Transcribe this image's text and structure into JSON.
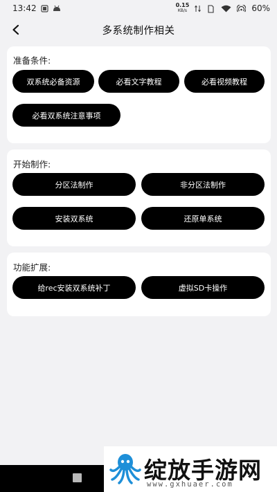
{
  "status_bar": {
    "time": "13:42",
    "net_speed_value": "0.15",
    "net_speed_unit": "KB/s",
    "battery": "60%"
  },
  "header": {
    "title": "多系统制作相关"
  },
  "sections": {
    "prepare": {
      "title": "准备条件:",
      "buttons": [
        "双系统必备资源",
        "必看文字教程",
        "必看视频教程",
        "必看双系统注意事项"
      ]
    },
    "make": {
      "title": "开始制作:",
      "buttons": [
        "分区法制作",
        "非分区法制作",
        "安装双系统",
        "还原单系统"
      ]
    },
    "extend": {
      "title": "功能扩展:",
      "buttons": [
        "给rec安装双系统补丁",
        "虚拟SD卡操作"
      ]
    }
  },
  "watermark": {
    "name": "绽放手游网",
    "url": "www.gxhuaer.com"
  },
  "colors": {
    "button_bg": "#000000",
    "button_text": "#ffffff",
    "page_bg": "#f2f2f4",
    "card_bg": "#ffffff",
    "logo_blue": "#1e8fd8"
  }
}
